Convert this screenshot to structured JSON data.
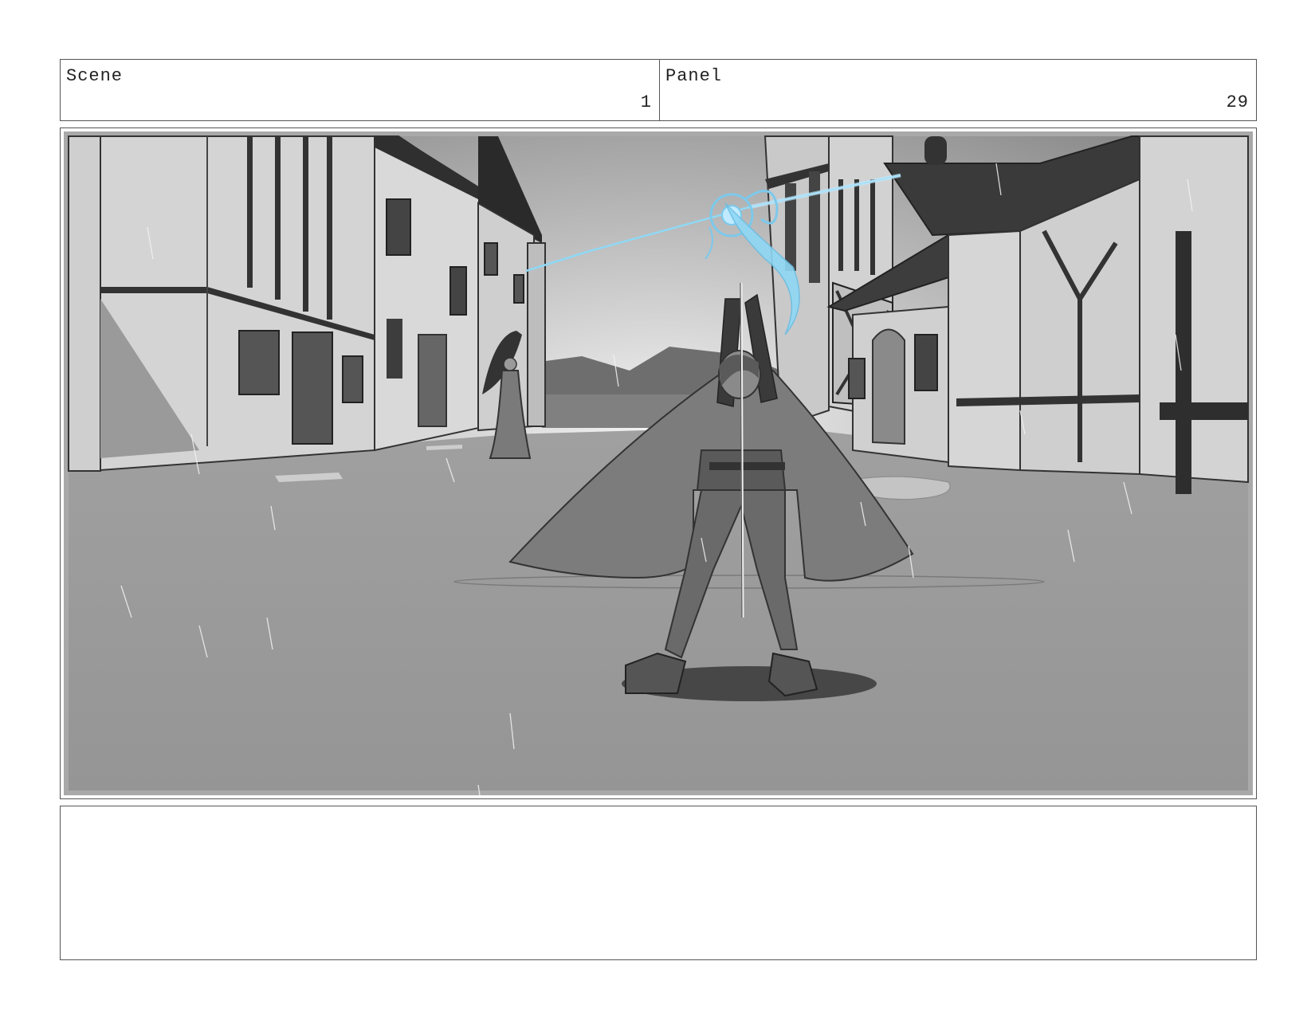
{
  "header": {
    "scene_label": "Scene",
    "scene_number": "1",
    "panel_label": "Panel",
    "panel_number": "29"
  },
  "frame": {
    "image": "storyboard-illustration-rainy-street-figure-raising-glowing-staff",
    "accent_color": "#8fd8f5"
  },
  "notes": {
    "text": ""
  }
}
